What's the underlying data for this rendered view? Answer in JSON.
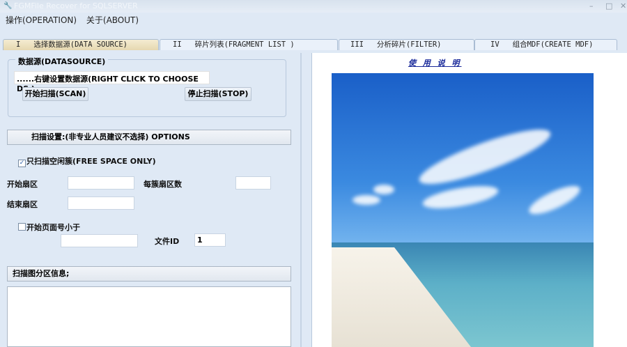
{
  "window": {
    "title": "FGMFile Recover for SQLSERVER"
  },
  "menu": [
    {
      "label": "操作(OPERATION)"
    },
    {
      "label": "关于(ABOUT)"
    }
  ],
  "tabs": [
    {
      "label": "I   选择数据源(DATA SOURCE)"
    },
    {
      "label": "II   碎片列表(FRAGMENT LIST )"
    },
    {
      "label": "III   分析碎片(FILTER)"
    },
    {
      "label": "IV   组合MDF(CREATE MDF)"
    }
  ],
  "datasource": {
    "legend": "数据源(DATASOURCE)",
    "field": "......右键设置数据源(RIGHT CLICK TO CHOOSE DS )",
    "scan": "开始扫描(SCAN)",
    "stop": "停止扫描(STOP)"
  },
  "options": {
    "header": "扫描设置:(非专业人员建议不选择) OPTIONS",
    "free_space": "只扫描空闲簇(FREE SPACE ONLY)",
    "free_space_checked": true,
    "start_sector": "开始扇区",
    "sectors_per_cluster": "每簇扇区数",
    "end_sector": "结束扇区",
    "page_lt": "开始页面号小于",
    "page_lt_checked": false,
    "file_id_label": "文件ID",
    "file_id": "1"
  },
  "partition": {
    "header": "扫描图分区信息;"
  },
  "help": {
    "label": "使 用 说 明"
  }
}
